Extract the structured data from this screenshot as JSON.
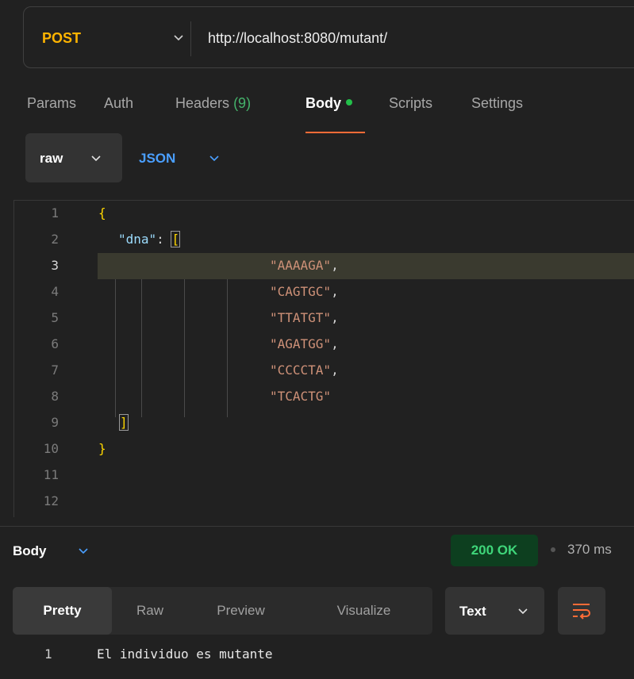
{
  "request": {
    "method": "POST",
    "url": "http://localhost:8080/mutant/"
  },
  "tabs": {
    "params": "Params",
    "auth": "Auth",
    "headers": "Headers",
    "headers_count": "(9)",
    "body": "Body",
    "scripts": "Scripts",
    "settings": "Settings"
  },
  "body_mode": {
    "raw": "raw",
    "format": "JSON"
  },
  "editor": {
    "line_numbers": [
      "1",
      "2",
      "3",
      "4",
      "5",
      "6",
      "7",
      "8",
      "9",
      "10",
      "11",
      "12"
    ],
    "open_brace": "{",
    "key": "\"dna\"",
    "colon": ": ",
    "open_bracket": "[",
    "strings": [
      "\"AAAAGA\"",
      "\"CAGTGC\"",
      "\"TTATGT\"",
      "\"AGATGG\"",
      "\"CCCCTA\"",
      "\"TCACTG\""
    ],
    "comma": ",",
    "close_bracket": "]",
    "close_brace": "}"
  },
  "response": {
    "body_label": "Body",
    "status": "200 OK",
    "time": "370 ms",
    "views": {
      "pretty": "Pretty",
      "raw": "Raw",
      "preview": "Preview",
      "visualize": "Visualize"
    },
    "format": "Text",
    "output_line_number": "1",
    "output": "El individuo es mutante"
  },
  "colors": {
    "method": "#ffb400",
    "active_tab_underline": "#ff6c37",
    "json_link": "#4a9fff",
    "status_ok": "#3fd67a",
    "string": "#ce9178",
    "key": "#9cdcfe",
    "brace": "#ffd700"
  },
  "icons": [
    "chevron-down-icon",
    "wrap-lines-icon"
  ]
}
